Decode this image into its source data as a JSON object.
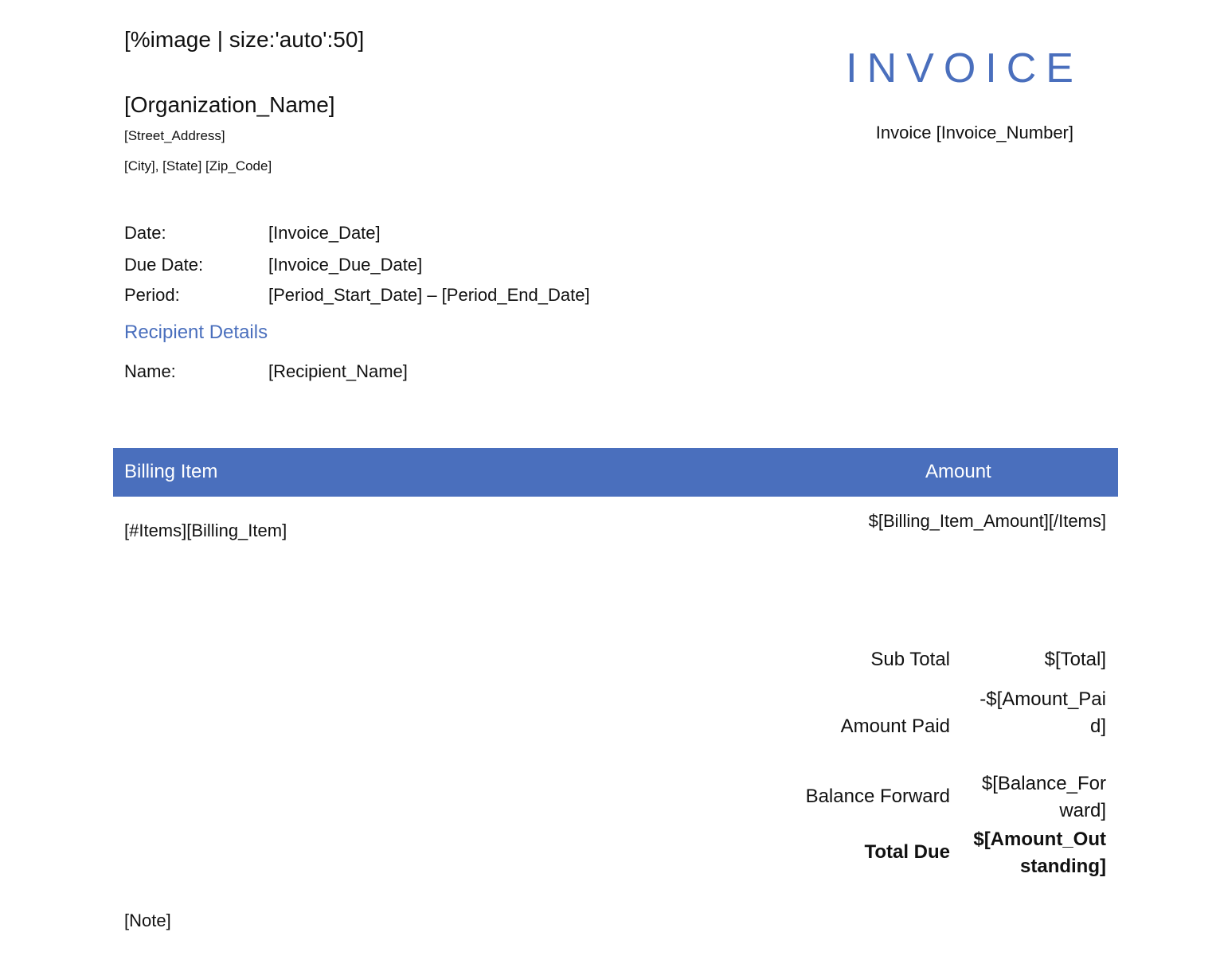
{
  "header": {
    "logo_placeholder": "[%image | size:'auto':50]",
    "title": "INVOICE",
    "invoice_number_line": "Invoice [Invoice_Number]"
  },
  "organization": {
    "name": "[Organization_Name]",
    "street": "[Street_Address]",
    "city_state_zip": "[City], [State] [Zip_Code]"
  },
  "meta": {
    "date_label": "Date:",
    "date_value": "[Invoice_Date]",
    "due_label": "Due Date:",
    "due_value": "[Invoice_Due_Date]",
    "period_label": "Period:",
    "period_value": "[Period_Start_Date] – [Period_End_Date]"
  },
  "recipient": {
    "heading": "Recipient Details",
    "name_label": "Name:",
    "name_value": "[Recipient_Name]"
  },
  "table": {
    "columns": [
      "Billing Item",
      "Amount"
    ],
    "rows": [
      {
        "item": "[#Items][Billing_Item]",
        "amount": "$[Billing_Item_Amount][/Items]"
      }
    ]
  },
  "summary": {
    "subtotal_label": "Sub Total",
    "subtotal_value": "$[Total]",
    "paid_label": "Amount Paid",
    "paid_value": "-$[Amount_Paid]",
    "balance_label": "Balance Forward",
    "balance_value": "$[Balance_Forward]",
    "total_label": "Total Due",
    "total_value": "$[Amount_Outstanding]"
  },
  "note": "[Note]",
  "colors": {
    "accent": "#4a6fbd",
    "text": "#111111"
  }
}
